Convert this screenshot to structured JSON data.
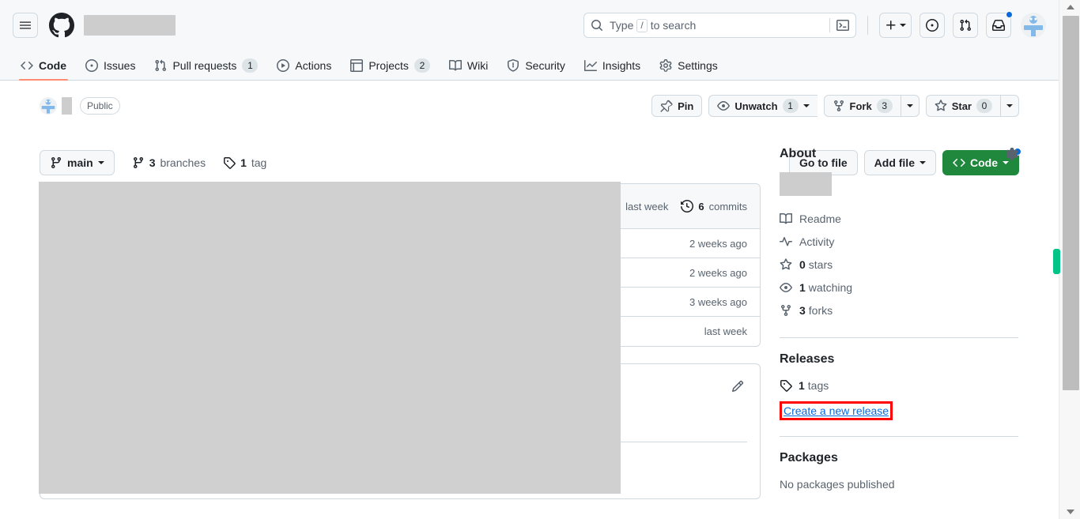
{
  "header": {
    "hamburger_icon": "hamburger-menu-icon",
    "logo_icon": "github-logo-icon",
    "repo_name_redacted": "",
    "search": {
      "placeholder_prefix": "Type",
      "slash_key": "/",
      "placeholder_suffix": "to search",
      "search_icon": "search-icon",
      "terminal_icon": "terminal-icon"
    },
    "actions": [
      {
        "name": "create-new-button",
        "icon": "plus-icon",
        "has_caret": true
      },
      {
        "name": "issues-button",
        "icon": "issue-opened-icon",
        "has_caret": false
      },
      {
        "name": "pull-requests-button",
        "icon": "git-pull-request-icon",
        "has_caret": false
      },
      {
        "name": "inbox-button",
        "icon": "inbox-icon",
        "has_caret": false,
        "has_dot": true
      }
    ],
    "avatar": "user-avatar"
  },
  "nav": {
    "tabs": [
      {
        "label": "Code",
        "icon": "code-icon",
        "count": null,
        "selected": true
      },
      {
        "label": "Issues",
        "icon": "issue-opened-icon",
        "count": null,
        "selected": false
      },
      {
        "label": "Pull requests",
        "icon": "git-pull-request-icon",
        "count": "1",
        "selected": false
      },
      {
        "label": "Actions",
        "icon": "play-icon",
        "count": null,
        "selected": false
      },
      {
        "label": "Projects",
        "icon": "table-icon",
        "count": "2",
        "selected": false
      },
      {
        "label": "Wiki",
        "icon": "book-icon",
        "count": null,
        "selected": false
      },
      {
        "label": "Security",
        "icon": "shield-icon",
        "count": null,
        "selected": false
      },
      {
        "label": "Insights",
        "icon": "graph-icon",
        "count": null,
        "selected": false
      },
      {
        "label": "Settings",
        "icon": "gear-icon",
        "count": null,
        "selected": false
      }
    ]
  },
  "repo": {
    "owner_avatar": "owner-avatar",
    "name_redacted": "",
    "visibility": "Public",
    "buttons": {
      "pin": {
        "label": "Pin",
        "icon": "pin-icon"
      },
      "unwatch": {
        "label": "Unwatch",
        "icon": "eye-icon",
        "count": "1"
      },
      "fork": {
        "label": "Fork",
        "icon": "repo-forked-icon",
        "count": "3"
      },
      "star": {
        "label": "Star",
        "icon": "star-icon",
        "count": "0"
      }
    }
  },
  "toolbar": {
    "branch": {
      "label": "main",
      "icon": "git-branch-icon"
    },
    "branches": {
      "count": "3",
      "label": "branches",
      "icon": "git-branch-icon"
    },
    "tags": {
      "count": "1",
      "label": "tag",
      "icon": "tag-icon"
    },
    "go_to_file": "Go to file",
    "add_file": "Add file",
    "code": {
      "label": "Code",
      "icon": "code-icon"
    }
  },
  "files": {
    "latest_commit_time": "last week",
    "commits": {
      "count": "6",
      "label": "commits",
      "icon": "history-icon"
    },
    "rows": [
      {
        "time": "2 weeks ago"
      },
      {
        "time": "2 weeks ago"
      },
      {
        "time": "3 weeks ago"
      },
      {
        "time": "last week"
      }
    ]
  },
  "readme": {
    "edit_icon": "pencil-icon"
  },
  "sidebar": {
    "about": {
      "title": "About",
      "settings_icon": "gear-icon",
      "description_redacted": "",
      "items": [
        {
          "label": "Readme",
          "icon": "book-icon",
          "bold_prefix": ""
        },
        {
          "label": "Activity",
          "icon": "pulse-icon",
          "bold_prefix": ""
        },
        {
          "label": "stars",
          "icon": "star-icon",
          "bold_prefix": "0"
        },
        {
          "label": "watching",
          "icon": "eye-icon",
          "bold_prefix": "1"
        },
        {
          "label": "forks",
          "icon": "repo-forked-icon",
          "bold_prefix": "3"
        }
      ]
    },
    "releases": {
      "title": "Releases",
      "tags_count": "1",
      "tags_label": "tags",
      "tags_icon": "tag-icon",
      "create_link": "Create a new release"
    },
    "packages": {
      "title": "Packages",
      "empty_text": "No packages published"
    }
  },
  "colors": {
    "accent_green": "#1f883d",
    "link_blue": "#0969da",
    "tab_underline": "#fd8c73",
    "highlight_red": "#ff0000",
    "scroll_marker_green": "#00c586",
    "redaction_grey": "#d0d0d0"
  }
}
